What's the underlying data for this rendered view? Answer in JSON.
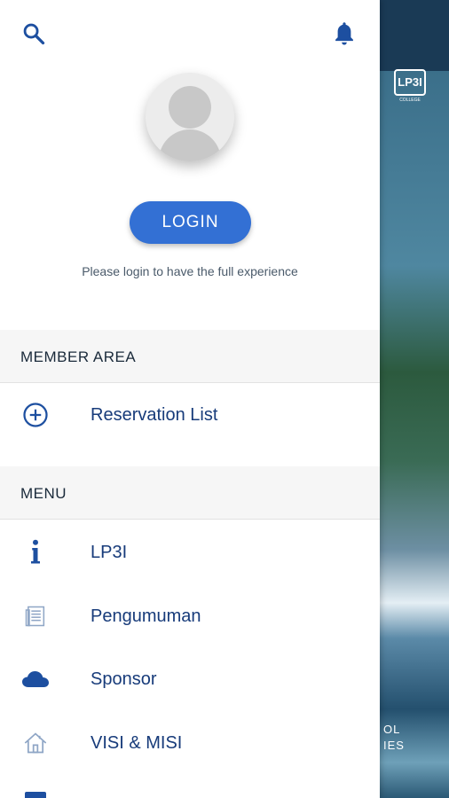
{
  "background": {
    "logo_text": "LP3I",
    "logo_sub": "COLLEGE",
    "partial_text_line1": "OL",
    "partial_text_line2": "IES"
  },
  "header": {
    "search_icon": "search-icon",
    "bell_icon": "bell-icon"
  },
  "profile": {
    "login_label": "LOGIN",
    "hint": "Please login to have the full experience"
  },
  "member_area": {
    "title": "MEMBER AREA",
    "items": [
      {
        "label": "Reservation List",
        "icon": "add-circle-icon"
      }
    ]
  },
  "menu": {
    "title": "MENU",
    "items": [
      {
        "label": "LP3I",
        "icon": "info-icon"
      },
      {
        "label": "Pengumuman",
        "icon": "newspaper-icon"
      },
      {
        "label": "Sponsor",
        "icon": "cloud-icon"
      },
      {
        "label": "VISI & MISI",
        "icon": "home-icon"
      }
    ]
  },
  "colors": {
    "accent": "#3370d4",
    "icon": "#1d4fa0",
    "label": "#173b7a"
  }
}
